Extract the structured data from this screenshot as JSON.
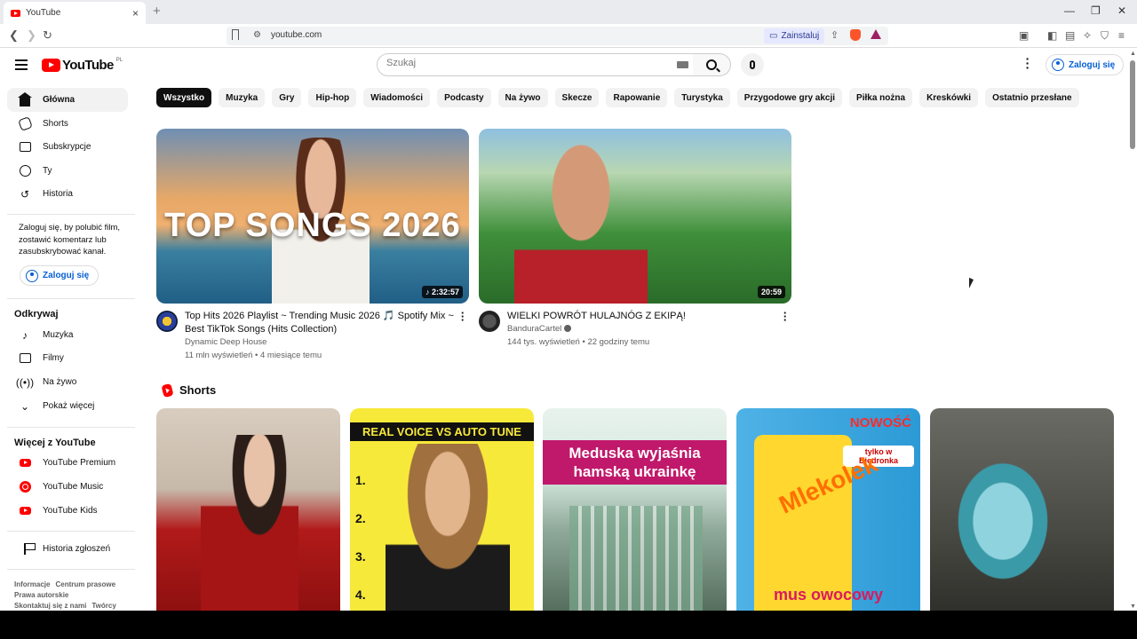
{
  "browser": {
    "tab_title": "YouTube",
    "tab_close": "×",
    "new_tab": "+",
    "url": "youtube.com",
    "install_label": "Zainstaluj"
  },
  "masthead": {
    "logo_text": "YouTube",
    "country_code": "PL",
    "search_placeholder": "Szukaj",
    "signin_label": "Zaloguj się"
  },
  "sidebar": {
    "main_items": [
      {
        "label": "Główna",
        "icon": "home-icon"
      },
      {
        "label": "Shorts",
        "icon": "shorts-icon"
      },
      {
        "label": "Subskrypcje",
        "icon": "subscriptions-icon"
      },
      {
        "label": "Ty",
        "icon": "you-icon"
      },
      {
        "label": "Historia",
        "icon": "history-icon"
      }
    ],
    "signin_note": "Zaloguj się, by polubić film, zostawić komentarz lub zasubskrybować kanał.",
    "signin_label": "Zaloguj się",
    "explore_title": "Odkrywaj",
    "explore_items": [
      {
        "label": "Muzyka",
        "icon": "music-note-icon"
      },
      {
        "label": "Filmy",
        "icon": "film-icon"
      },
      {
        "label": "Na żywo",
        "icon": "live-icon"
      },
      {
        "label": "Pokaż więcej",
        "icon": "chevron-down-icon"
      }
    ],
    "more_title": "Więcej z YouTube",
    "more_items": [
      {
        "label": "YouTube Premium",
        "icon": "youtube-premium-icon"
      },
      {
        "label": "YouTube Music",
        "icon": "youtube-music-icon"
      },
      {
        "label": "YouTube Kids",
        "icon": "youtube-kids-icon"
      }
    ],
    "report_history": "Historia zgłoszeń",
    "footer_links": [
      "Informacje",
      "Centrum prasowe",
      "Prawa autorskie",
      "Skontaktuj się z nami",
      "Twórcy"
    ]
  },
  "chips": [
    "Wszystko",
    "Muzyka",
    "Gry",
    "Hip-hop",
    "Wiadomości",
    "Podcasty",
    "Na żywo",
    "Skecze",
    "Rapowanie",
    "Turystyka",
    "Przygodowe gry akcji",
    "Piłka nożna",
    "Kreskówki",
    "Ostatnio przesłane"
  ],
  "videos": [
    {
      "thumb_text": "TOP SONGS 2026",
      "duration": "♪ 2:32:57",
      "title": "Top Hits 2026 Playlist ~ Trending Music 2026 🎵 Spotify Mix ~ Best TikTok Songs (Hits Collection)",
      "channel": "Dynamic Deep House",
      "stats": "11 mln wyświetleń • 4 miesiące temu"
    },
    {
      "thumb_text": "",
      "duration": "20:59",
      "title": "WIELKI POWRÓT HULAJNÓG Z EKIPĄ!",
      "channel": "BanduraCartel",
      "stats": "144 tys. wyświetleń • 22 godziny temu"
    }
  ],
  "shorts": {
    "title": "Shorts",
    "items": [
      {
        "caption": ""
      },
      {
        "caption": "REAL VOICE VS AUTO TUNE",
        "numbers": [
          "1.",
          "2.",
          "3.",
          "4."
        ]
      },
      {
        "caption": "Meduska wyjaśnia hamską ukrainkę"
      },
      {
        "caption": "NOWOŚĆ",
        "badge": "tylko w Biedronka",
        "brand": "Mlekolek",
        "bottom": "mus owocowy"
      },
      {
        "caption": ""
      }
    ]
  },
  "colors": {
    "brand_red": "#ff0000",
    "link_blue": "#065fd4"
  }
}
